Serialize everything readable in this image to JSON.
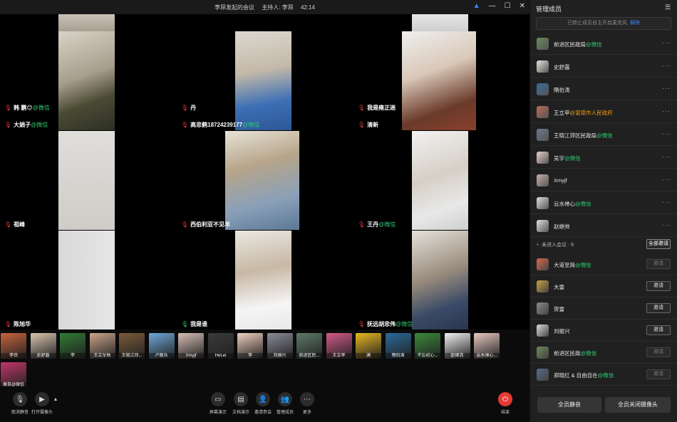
{
  "titlebar": {
    "title": "李昂发起的会议",
    "host": "主持人: 李昂",
    "duration": "42:14"
  },
  "tiles": [
    {
      "name": "韩 鹏😊",
      "tag": "@微信",
      "mic": "muted"
    },
    {
      "name": "丹",
      "tag": "",
      "mic": "muted"
    },
    {
      "name": "我是雍正迷",
      "tag": "",
      "mic": "muted"
    },
    {
      "name": "大娟子",
      "tag": "@微信",
      "mic": "muted"
    },
    {
      "name": "高忠鹤18724239177",
      "tag": "@微信",
      "mic": "muted"
    },
    {
      "name": "清新",
      "tag": "",
      "mic": "muted"
    },
    {
      "name": "祖峰",
      "tag": "",
      "mic": "muted"
    },
    {
      "name": "西伯利亚不见羊",
      "tag": "",
      "mic": "muted"
    },
    {
      "name": "王丹",
      "tag": "@微信",
      "mic": "muted"
    },
    {
      "name": "陈旭华",
      "tag": "",
      "mic": "muted"
    },
    {
      "name": "我是谁",
      "tag": "",
      "mic": "on"
    },
    {
      "name": "抚远胡忠伟",
      "tag": "@微信",
      "mic": "muted"
    }
  ],
  "thumbs": [
    "李昂",
    "史舒露",
    "李",
    "王立军秋",
    "王晓江郊...",
    "卢丽兵",
    "Xmyjf",
    "HeLei",
    "李",
    "刘振兴",
    "前进区民...",
    "王立苹",
    "满",
    "隋伯涛",
    "不忘初心...",
    "赵继尧",
    "云水禅心...",
    "章目@微信"
  ],
  "toolbar": {
    "mute": "取消静音",
    "camera": "打开摄像头",
    "share": "屏幕演示",
    "docs": "文档演示",
    "invite": "邀请参会",
    "members": "管理成员",
    "more": "更多",
    "end": "结束"
  },
  "panel": {
    "title": "管理成员",
    "notice": "已禁止成员自主开启麦克风",
    "notice_link": "解除",
    "members": [
      {
        "name": "前进区民政局",
        "tag": "@微信",
        "org": ""
      },
      {
        "name": "史舒露",
        "tag": "",
        "org": ""
      },
      {
        "name": "隋伯涛",
        "tag": "",
        "org": ""
      },
      {
        "name": "王立苹",
        "tag": "",
        "org": "@富锦市人民政府"
      },
      {
        "name": "王晓江郊区民政局",
        "tag": "@微信",
        "org": ""
      },
      {
        "name": "吴宇",
        "tag": "@微信",
        "org": ""
      },
      {
        "name": "Xmyjf",
        "tag": "",
        "org": ""
      },
      {
        "name": "云水禅心",
        "tag": "@微信",
        "org": ""
      },
      {
        "name": "赵继帅",
        "tag": "",
        "org": ""
      }
    ],
    "not_joined_label": "未进入会议 · 6",
    "invite_all": "全部邀请",
    "invite_label": "邀请",
    "not_joined": [
      {
        "name": "大道至简",
        "tag": "@微信",
        "dim": true
      },
      {
        "name": "大雷",
        "tag": "",
        "dim": false
      },
      {
        "name": "贺雷",
        "tag": "",
        "dim": false
      },
      {
        "name": "刘振兴",
        "tag": "",
        "dim": false
      },
      {
        "name": "前进区民政",
        "tag": "@微信",
        "dim": true
      },
      {
        "name": "郑晓红 & 自由自在",
        "tag": "@微信",
        "dim": true
      }
    ],
    "mute_all": "全员静音",
    "cam_off_all": "全员关闭摄像头"
  }
}
